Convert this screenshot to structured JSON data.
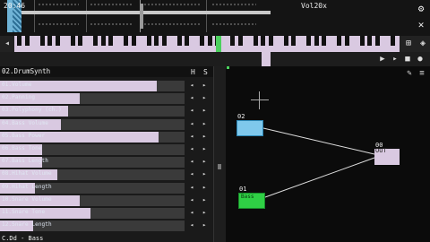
{
  "toolbar": {
    "time": "20:46",
    "volume": "Vol20x",
    "left_arrow": "◂"
  },
  "panel": {
    "instrument": "02.DrumSynth",
    "col_h": "H",
    "col_s": "S",
    "params": [
      {
        "label": "01.Volume",
        "level": 0.85
      },
      {
        "label": "02.Panning",
        "level": 0.43
      },
      {
        "label": "03.Polyphony (ch.)",
        "level": 0.37
      },
      {
        "label": "04.Bass Volume",
        "level": 0.33
      },
      {
        "label": "05.Bass Power",
        "level": 0.86
      },
      {
        "label": "06.Bass Tone",
        "level": 0.23
      },
      {
        "label": "07.Bass Length",
        "level": 0.23
      },
      {
        "label": "08.Hihat Volume",
        "level": 0.31
      },
      {
        "label": "09.Hihat Length",
        "level": 0.19
      },
      {
        "label": "10.Snare Volume",
        "level": 0.43
      },
      {
        "label": "11.Snare Tone",
        "level": 0.49
      },
      {
        "label": "12.Snare Length",
        "level": 0.18
      }
    ],
    "footer": "C.Dd - Bass"
  },
  "nodes": {
    "drum_id": "02",
    "bass_id": "01",
    "bass_label": "Bass",
    "out_id": "00",
    "out_label": "OUT"
  },
  "colors": {
    "accent_blue": "#7fc8ec",
    "accent_green": "#2fd045",
    "bar_lilac": "#d9c9e1"
  }
}
